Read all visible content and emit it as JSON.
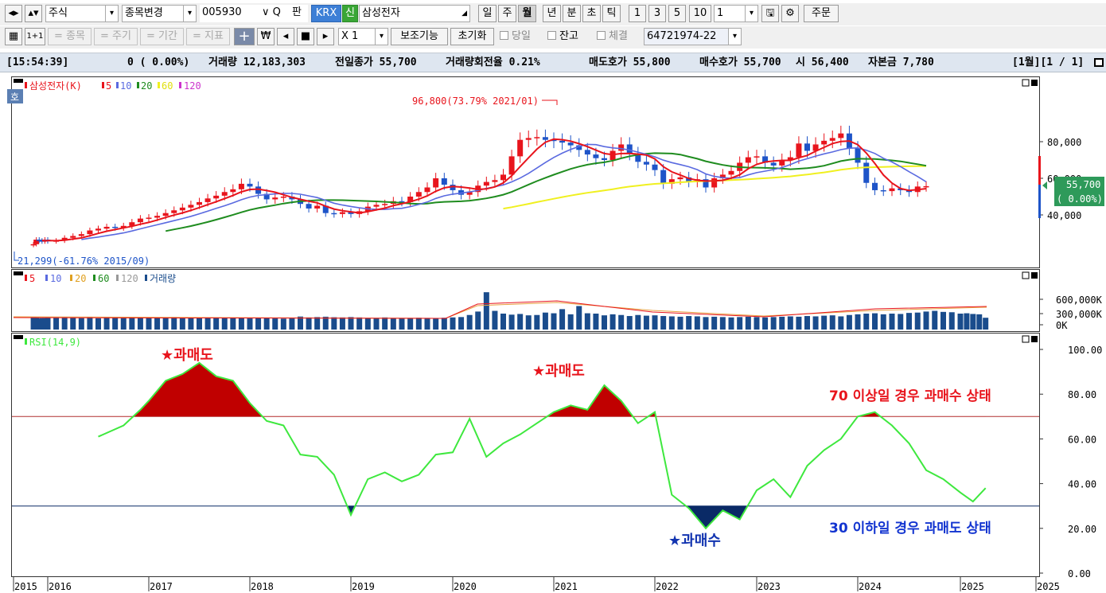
{
  "toolbar": {
    "market_type": "주식",
    "change_stock_label": "종목변경",
    "stock_code": "005930",
    "search_label": "판",
    "exchange_badge": "KRX",
    "credit_badge": "신",
    "stock_name": "삼성전자",
    "periods": [
      "일",
      "주",
      "월",
      "년",
      "분",
      "초",
      "틱"
    ],
    "active_period": "월",
    "intervals": [
      "1",
      "3",
      "5",
      "10"
    ],
    "interval_value": "1",
    "order_label": "주문"
  },
  "toolbar2": {
    "count_label": "1+1",
    "eq_stock": "= 종목",
    "eq_period": "= 주기",
    "eq_range": "= 기간",
    "eq_indicator": "= 지표",
    "cross_icon": "+",
    "won_icon": "₩",
    "multiplier_label": "X 1",
    "aux_label": "보조기능",
    "reset_label": "초기화",
    "today_label": "당일",
    "balance_label": "잔고",
    "execution_label": "체결",
    "account_value": "64721974-22"
  },
  "info": {
    "time": "[15:54:39]",
    "change": "0 ( 0.00%)",
    "volume": "거래량 12,183,303",
    "prev_close": "전일종가 55,700",
    "turnover": "거래량회전율 0.21%",
    "ask": "매도호가 55,800",
    "bid": "매수호가 55,700",
    "open": "시 56,400",
    "capital": "자본금 7,780",
    "page": "[1월][1 / 1]"
  },
  "price_panel": {
    "legend_title": "삼성전자(K)",
    "ma_labels": [
      "5",
      "10",
      "20",
      "60",
      "120"
    ],
    "high_annotation": "96,800(73.79% 2021/01)",
    "low_annotation": "21,299(-61.76% 2015/09)",
    "axis_ticks": [
      "80,000",
      "60,000",
      "40,000"
    ],
    "current_price": "55,700",
    "current_change": "( 0.00%)",
    "hoga_badge": "호"
  },
  "volume_panel": {
    "ma_labels": [
      "5",
      "10",
      "20",
      "60",
      "120"
    ],
    "title": "거래량",
    "axis_ticks": [
      "600,000K",
      "300,000K",
      "0K"
    ]
  },
  "rsi_panel": {
    "title": "RSI(14,9)",
    "axis_ticks": [
      "100.00",
      "80.00",
      "60.00",
      "40.00",
      "20.00",
      "0.00"
    ],
    "overbought_labels": [
      "★과매도",
      "★과매도"
    ],
    "oversold_label": "★과매수",
    "note_upper": "70 이상일 경우 과매수 상태",
    "note_lower": "30 이하일 경우 과매도 상태"
  },
  "x_axis": [
    "2015",
    "2016",
    "2017",
    "2018",
    "2019",
    "2020",
    "2021",
    "2022",
    "2023",
    "2024",
    "2025",
    "2025"
  ],
  "colors": {
    "candle_up": "#e8141c",
    "candle_down": "#1e54c8",
    "ma5": "#e8141c",
    "ma10": "#5a6ae0",
    "ma20": "#1f8c1f",
    "ma60": "#f0f020",
    "ma120": "#cc33cc",
    "rsi_line": "#3ee83e",
    "overbought_fill": "#c00000",
    "oversold_fill": "#0a2a66",
    "volume_bar": "#1a4c8c"
  },
  "chart_data": {
    "type": "line",
    "title": "RSI(14,9)",
    "x": [
      "2016-07",
      "2016-10",
      "2016-12",
      "2017-01",
      "2017-03",
      "2017-05",
      "2017-07",
      "2017-09",
      "2017-11",
      "2018-01",
      "2018-03",
      "2018-05",
      "2018-07",
      "2018-09",
      "2018-11",
      "2019-01",
      "2019-03",
      "2019-05",
      "2019-07",
      "2019-09",
      "2019-11",
      "2020-01",
      "2020-03",
      "2020-05",
      "2020-07",
      "2020-09",
      "2020-11",
      "2021-01",
      "2021-03",
      "2021-05",
      "2021-07",
      "2021-09",
      "2021-11",
      "2022-01",
      "2022-03",
      "2022-05",
      "2022-07",
      "2022-09",
      "2022-11",
      "2023-01",
      "2023-03",
      "2023-05",
      "2023-07",
      "2023-09",
      "2023-11",
      "2024-01",
      "2024-03",
      "2024-05",
      "2024-07",
      "2024-09",
      "2024-11",
      "2025-01",
      "2025-03",
      "2025-05"
    ],
    "y": [
      61,
      66,
      73,
      77,
      86,
      89,
      94,
      88,
      86,
      76,
      68,
      66,
      53,
      52,
      44,
      26,
      42,
      45,
      41,
      44,
      53,
      54,
      69,
      52,
      58,
      62,
      67,
      72,
      75,
      73,
      84,
      77,
      67,
      72,
      35,
      29,
      20,
      28,
      24,
      37,
      42,
      34,
      48,
      55,
      60,
      70,
      72,
      66,
      58,
      46,
      42,
      36,
      32,
      38
    ],
    "ylim": [
      0,
      100
    ],
    "reference_lines": [
      70,
      30
    ]
  }
}
